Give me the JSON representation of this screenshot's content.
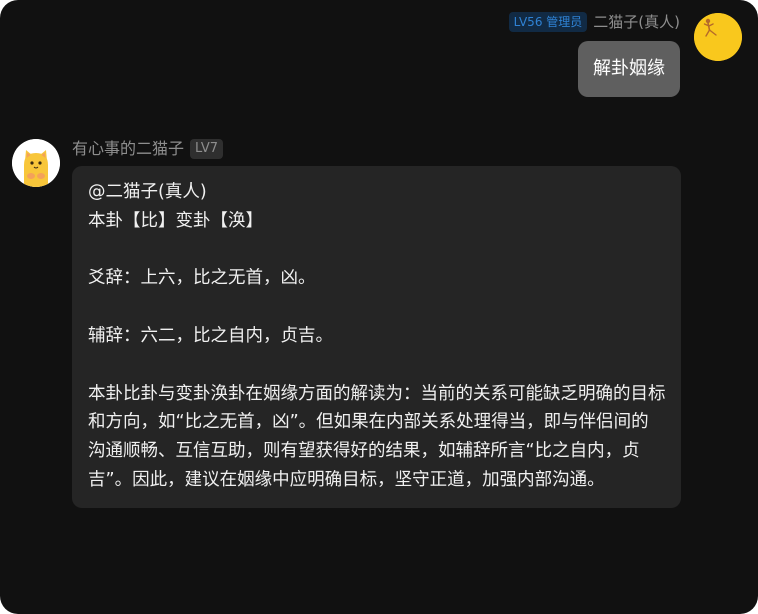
{
  "outgoing": {
    "badge": "LV56 管理员",
    "sender": "二猫子(真人)",
    "text": "解卦姻缘"
  },
  "incoming": {
    "sender": "有心事的二猫子",
    "level": "LV7",
    "lines": {
      "mention": "@二猫子(真人)",
      "hexagram": "本卦【比】变卦【涣】",
      "yaoci": "爻辞：上六，比之无首，凶。",
      "fuci": "辅辞：六二，比之自内，贞吉。",
      "interpretation": "本卦比卦与变卦涣卦在姻缘方面的解读为：当前的关系可能缺乏明确的目标和方向，如“比之无首，凶”。但如果在内部关系处理得当，即与伴侣间的沟通顺畅、互信互助，则有望获得好的结果，如辅辞所言“比之自内，贞吉”。因此，建议在姻缘中应明确目标，坚守正道，加强内部沟通。"
    }
  },
  "colors": {
    "window_bg": "#111111",
    "outgoing_bubble": "#5f5f5f",
    "incoming_bubble": "#252525",
    "admin_badge_bg": "#112a44",
    "admin_badge_text": "#2f82d4",
    "avatar_right_bg": "#f9c81d"
  },
  "icons": {
    "right_avatar": "dancing-stick-figure-avatar",
    "left_avatar": "cartoon-cat-avatar"
  }
}
